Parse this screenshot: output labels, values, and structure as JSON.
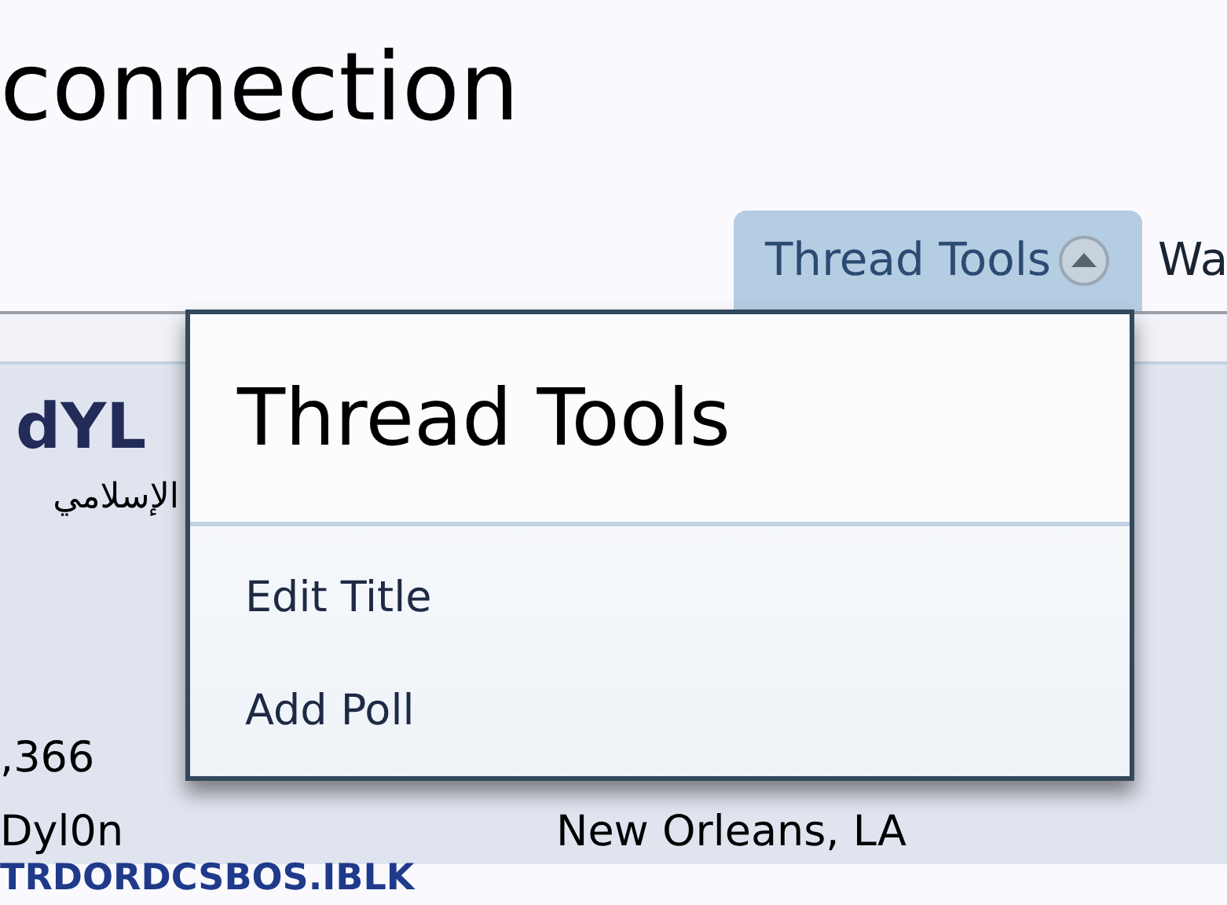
{
  "heading": "connection",
  "tabs": [
    {
      "label": "Thread Tools",
      "expanded": true
    },
    {
      "label": "Wa",
      "expanded": false
    }
  ],
  "post": {
    "username": "dYL",
    "user_title": "الإسلامي",
    "stats": [
      {
        "left": ",366"
      },
      {
        "left": "Dyl0n",
        "right": "New Orleans, LA"
      }
    ],
    "footer": "TRDORDCSBOS.IBLK"
  },
  "menu": {
    "title": "Thread Tools",
    "items": [
      "Edit Title",
      "Add Poll"
    ]
  }
}
